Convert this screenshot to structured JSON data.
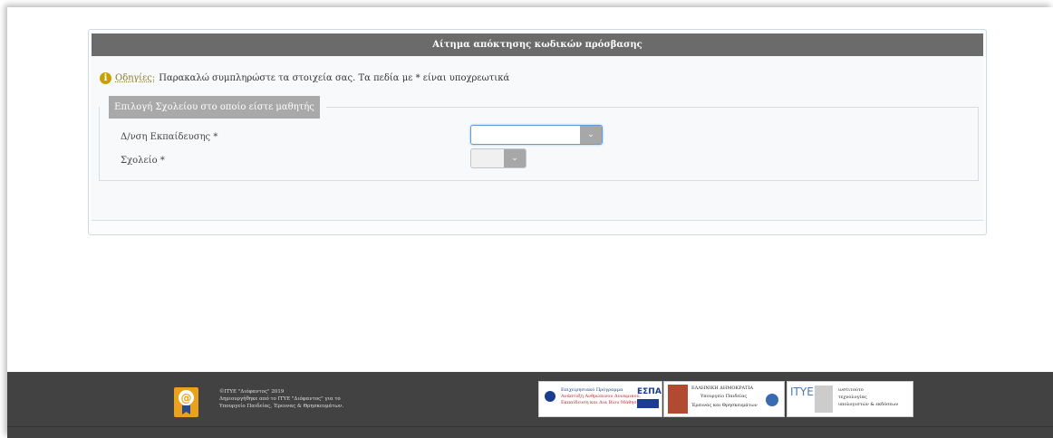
{
  "panel": {
    "title": "Αίτημα απόκτησης κωδικών πρόσβασης",
    "instructions_label": "Οδηγίες:",
    "instructions_text": "Παρακαλώ συμπληρώστε τα στοιχεία σας. Τα πεδία με * είναι υποχρεωτικά",
    "section_title": "Επιλογή Σχολείου στο οποίο είστε μαθητής"
  },
  "form": {
    "directorate_label": "Δ/νση Εκπαίδευσης *",
    "directorate_value": "",
    "school_label": "Σχολείο *",
    "school_value": ""
  },
  "footer": {
    "copyright_line1": "©ΙΤΥΕ \"Διόφαντος\" 2019",
    "copyright_line2": "Δημιουργήθηκε από το ΙΤΥΕ \"Διόφαντος\" για το",
    "copyright_line3": "Υπουργείο Παιδείας, Έρευνας & Θρησκευμάτων.",
    "partner1_line1": "Επιχειρησιακό Πρόγραμμα",
    "partner1_line2": "Ανάπτυξη Ανθρώπινου Δυναμικού,",
    "partner1_line3": "Εκπαίδευση και Δια Βίου Μάθηση",
    "partner1_espa": "ΕΣΠΑ",
    "partner2_line1": "ΕΛΛΗΝΙΚΗ ΔΗΜΟΚΡΑΤΙΑ",
    "partner2_line2": "Υπουργείο Παιδείας",
    "partner2_line3": "Έρευνας και Θρησκευμάτων",
    "partner3_line1": "ινστιτούτο",
    "partner3_line2": "τεχνολογίας",
    "partner3_line3": "υπολογιστών & εκδόσεων",
    "partner3_abbr": "ΙΤΥΕ"
  }
}
